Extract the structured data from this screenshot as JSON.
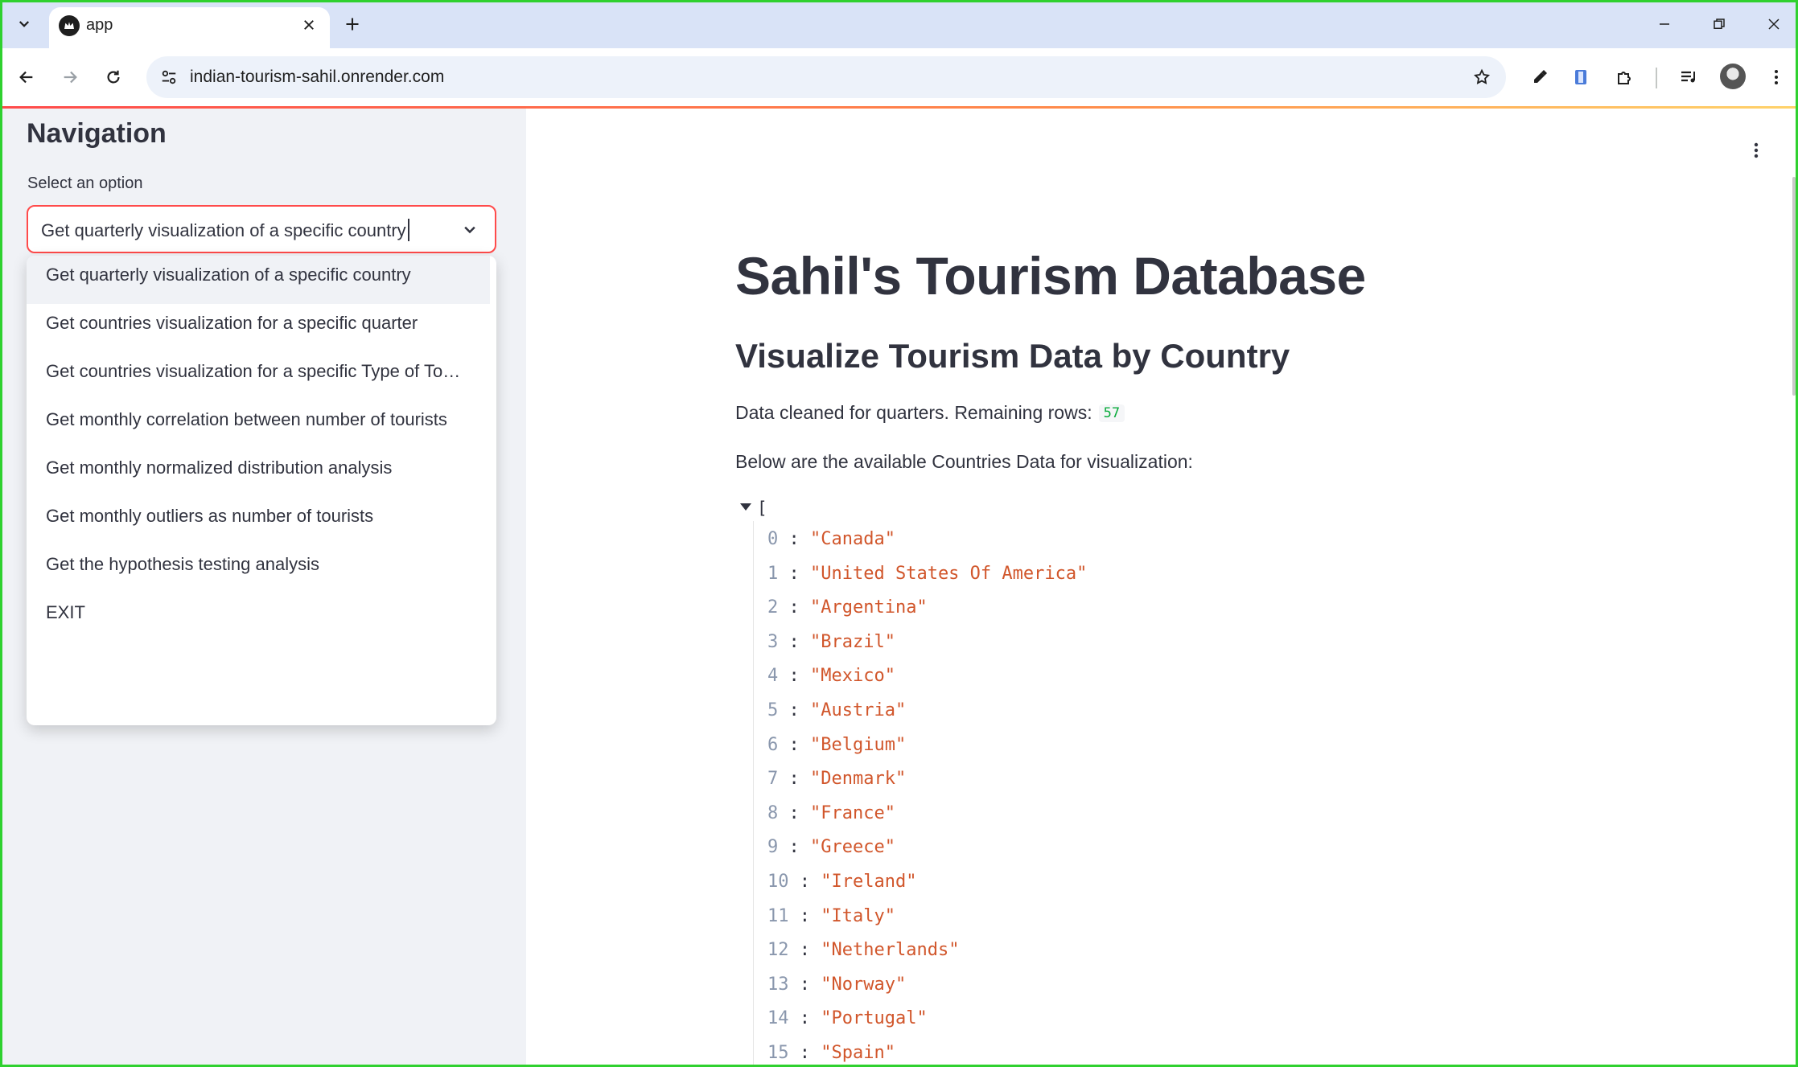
{
  "browser": {
    "tab_title": "app",
    "url": "indian-tourism-sahil.onrender.com"
  },
  "sidebar": {
    "title": "Navigation",
    "select_label": "Select an option",
    "selected_value": "Get quarterly visualization of a specific country",
    "options": [
      "Get quarterly visualization of a specific country",
      "Get countries visualization for a specific quarter",
      "Get countries visualization for a specific Type of To…",
      "Get monthly correlation between number of tourists",
      "Get monthly normalized distribution analysis",
      "Get monthly outliers as number of tourists",
      "Get the hypothesis testing analysis",
      "EXIT"
    ]
  },
  "main": {
    "title": "Sahil's Tourism Database",
    "subtitle": "Visualize Tourism Data by Country",
    "rows_text": "Data cleaned for quarters. Remaining rows:",
    "rows_count": "57",
    "available_text": "Below are the available Countries Data for visualization:",
    "json_open": "[",
    "countries": [
      {
        "index": "0",
        "value": "\"Canada\""
      },
      {
        "index": "1",
        "value": "\"United States Of America\""
      },
      {
        "index": "2",
        "value": "\"Argentina\""
      },
      {
        "index": "3",
        "value": "\"Brazil\""
      },
      {
        "index": "4",
        "value": "\"Mexico\""
      },
      {
        "index": "5",
        "value": "\"Austria\""
      },
      {
        "index": "6",
        "value": "\"Belgium\""
      },
      {
        "index": "7",
        "value": "\"Denmark\""
      },
      {
        "index": "8",
        "value": "\"France\""
      },
      {
        "index": "9",
        "value": "\"Greece\""
      },
      {
        "index": "10",
        "value": "\"Ireland\""
      },
      {
        "index": "11",
        "value": "\"Italy\""
      },
      {
        "index": "12",
        "value": "\"Netherlands\""
      },
      {
        "index": "13",
        "value": "\"Norway\""
      },
      {
        "index": "14",
        "value": "\"Portugal\""
      },
      {
        "index": "15",
        "value": "\"Spain\""
      }
    ]
  },
  "colors": {
    "accent": "#ff4b4b",
    "sidebar_bg": "#f0f2f6",
    "json_string": "#d1562b",
    "badge_green": "#09ab3b"
  }
}
